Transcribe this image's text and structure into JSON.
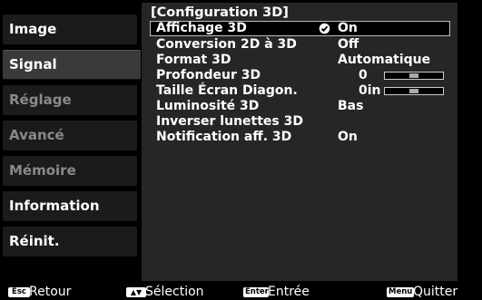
{
  "sidebar": {
    "items": [
      {
        "label": "Image",
        "state": "normal"
      },
      {
        "label": "Signal",
        "state": "selected"
      },
      {
        "label": "Réglage",
        "state": "dim"
      },
      {
        "label": "Avancé",
        "state": "dim"
      },
      {
        "label": "Mémoire",
        "state": "dim"
      },
      {
        "label": "Information",
        "state": "normal"
      },
      {
        "label": "Réinit.",
        "state": "normal"
      }
    ]
  },
  "panel": {
    "title": "[Configuration 3D]",
    "rows": [
      {
        "label": "Affichage 3D",
        "value": "On",
        "selected": true,
        "icon": "checked-radio-icon"
      },
      {
        "label": "Conversion 2D à 3D",
        "value": "Off"
      },
      {
        "label": "Format 3D",
        "value": "Automatique"
      },
      {
        "label": "Profondeur 3D",
        "value": "0",
        "slider_fraction": 0.5
      },
      {
        "label": "Taille Écran Diagon.",
        "value": "0in",
        "slider_fraction": 0.5
      },
      {
        "label": "Luminosité 3D",
        "value": "Bas"
      },
      {
        "label": "Inverser lunettes 3D",
        "value": ""
      },
      {
        "label": "Notification aff. 3D",
        "value": "On"
      }
    ]
  },
  "footer": {
    "retour": {
      "key": "Esc",
      "label": "Retour"
    },
    "selection": {
      "key": "▲▼",
      "label": "Sélection"
    },
    "entree": {
      "key": "Enter",
      "label": "Entrée"
    },
    "quitter": {
      "key": "Menu",
      "label": "Quitter"
    }
  },
  "colors": {
    "background": "#000000",
    "panel": "#262626",
    "sidebar_item": "#1b1b1b",
    "sidebar_selected": "#3a3a3a",
    "dim_text": "#8a8a8a"
  }
}
